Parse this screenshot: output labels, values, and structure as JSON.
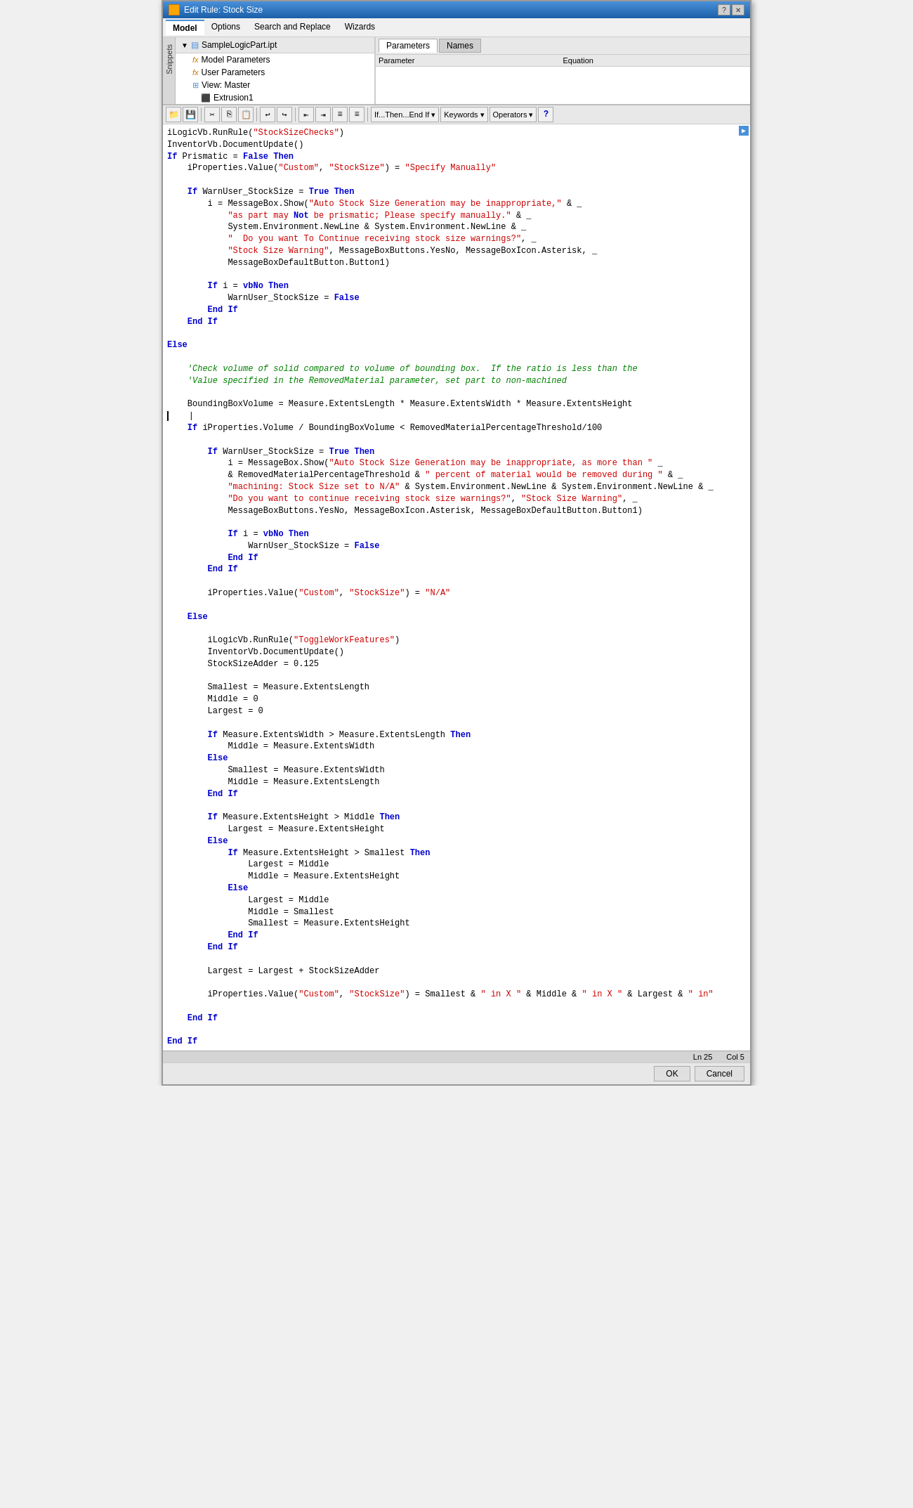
{
  "window": {
    "title": "Edit Rule: Stock Size",
    "icon": "edit-rule-icon"
  },
  "menu": {
    "tabs": [
      "Model",
      "Options",
      "Search and Replace",
      "Wizards"
    ],
    "active_tab": "Model"
  },
  "snippets": {
    "label": "Snippets"
  },
  "tree": {
    "root_label": "SampleLogicPart.ipt",
    "items": [
      {
        "label": "Model Parameters",
        "icon": "fx-icon",
        "indent": 1
      },
      {
        "label": "User Parameters",
        "icon": "fx-icon",
        "indent": 1
      },
      {
        "label": "View: Master",
        "icon": "view-icon",
        "indent": 1
      },
      {
        "label": "Extrusion1",
        "icon": "extrusion-icon",
        "indent": 2
      }
    ]
  },
  "params": {
    "tabs": [
      "Parameters",
      "Names"
    ],
    "active_tab": "Parameters",
    "columns": [
      "Parameter",
      "Equation"
    ]
  },
  "toolbar": {
    "buttons": [
      "open",
      "save",
      "cut",
      "copy",
      "paste",
      "undo",
      "redo",
      "indent-left",
      "indent-right",
      "align-left",
      "align-right"
    ],
    "dropdowns": [
      "If...Then...End If",
      "Keywords",
      "Operators"
    ],
    "help_icon": "help-icon"
  },
  "code": {
    "lines": [
      {
        "text": "iLogicVb.RunRule(\"StockSizeChecks\")",
        "type": "normal"
      },
      {
        "text": "InventorVb.DocumentUpdate()",
        "type": "normal"
      },
      {
        "text": "If Prismatic = False Then",
        "type": "keyword_line"
      },
      {
        "text": "    iProperties.Value(\"Custom\", \"StockSize\") = \"Specify Manually\"",
        "type": "mixed"
      },
      {
        "text": "",
        "type": "blank"
      },
      {
        "text": "    If WarnUser_StockSize = True Then",
        "type": "keyword_line"
      },
      {
        "text": "        i = MessageBox.Show(\"Auto Stock Size Generation may be inappropriate,\" & _",
        "type": "mixed"
      },
      {
        "text": "            \"as part may Not be prismatic; Please specify manually.\" & _",
        "type": "string_line"
      },
      {
        "text": "            System.Environment.NewLine & System.Environment.NewLine & _",
        "type": "mixed"
      },
      {
        "text": "            \"  Do you want To Continue receiving stock size warnings?\", _",
        "type": "string_line"
      },
      {
        "text": "            \"Stock Size Warning\", MessageBoxButtons.YesNo, MessageBoxIcon.Asterisk, _",
        "type": "string_line"
      },
      {
        "text": "            MessageBoxDefaultButton.Button1)",
        "type": "normal"
      },
      {
        "text": "",
        "type": "blank"
      },
      {
        "text": "        If i = vbNo Then",
        "type": "keyword_line"
      },
      {
        "text": "            WarnUser_StockSize = False",
        "type": "normal"
      },
      {
        "text": "        End If",
        "type": "keyword_line"
      },
      {
        "text": "    End If",
        "type": "keyword_line"
      },
      {
        "text": "",
        "type": "blank"
      },
      {
        "text": "Else",
        "type": "keyword_line"
      },
      {
        "text": "",
        "type": "blank"
      },
      {
        "text": "    'Check volume of solid compared to volume of bounding box.  If the ratio is less than the",
        "type": "comment"
      },
      {
        "text": "    'Value specified in the RemovedMaterial parameter, set part to non-machined",
        "type": "comment"
      },
      {
        "text": "",
        "type": "blank"
      },
      {
        "text": "    BoundingBoxVolume = Measure.ExtentsLength * Measure.ExtentsWidth * Measure.ExtentsHeight",
        "type": "normal"
      },
      {
        "text": "    |",
        "type": "cursor"
      },
      {
        "text": "    If iProperties.Volume / BoundingBoxVolume < RemovedMaterialPercentageThreshold/100",
        "type": "keyword_line"
      },
      {
        "text": "",
        "type": "blank"
      },
      {
        "text": "        If WarnUser_StockSize = True Then",
        "type": "keyword_line"
      },
      {
        "text": "            i = MessageBox.Show(\"Auto Stock Size Generation may be inappropriate, as more than \" _",
        "type": "mixed"
      },
      {
        "text": "            & RemovedMaterialPercentageThreshold & \" percent of material would be removed during \" & _",
        "type": "mixed"
      },
      {
        "text": "            \"machining: Stock Size set to N/A\" & System.Environment.NewLine & System.Environment.NewLine & _",
        "type": "string_line"
      },
      {
        "text": "            \"Do you want to continue receiving stock size warnings?\", \"Stock Size Warning\", _",
        "type": "string_line"
      },
      {
        "text": "            MessageBoxButtons.YesNo, MessageBoxIcon.Asterisk, MessageBoxDefaultButton.Button1)",
        "type": "normal"
      },
      {
        "text": "",
        "type": "blank"
      },
      {
        "text": "            If i = vbNo Then",
        "type": "keyword_line"
      },
      {
        "text": "                WarnUser_StockSize = False",
        "type": "normal"
      },
      {
        "text": "            End If",
        "type": "keyword_line"
      },
      {
        "text": "        End If",
        "type": "keyword_line"
      },
      {
        "text": "",
        "type": "blank"
      },
      {
        "text": "        iProperties.Value(\"Custom\", \"StockSize\") = \"N/A\"",
        "type": "mixed"
      },
      {
        "text": "",
        "type": "blank"
      },
      {
        "text": "    Else",
        "type": "keyword_line"
      },
      {
        "text": "",
        "type": "blank"
      },
      {
        "text": "        iLogicVb.RunRule(\"ToggleWorkFeatures\")",
        "type": "normal"
      },
      {
        "text": "        InventorVb.DocumentUpdate()",
        "type": "normal"
      },
      {
        "text": "        StockSizeAdder = 0.125",
        "type": "normal"
      },
      {
        "text": "",
        "type": "blank"
      },
      {
        "text": "        Smallest = Measure.ExtentsLength",
        "type": "normal"
      },
      {
        "text": "        Middle = 0",
        "type": "normal"
      },
      {
        "text": "        Largest = 0",
        "type": "normal"
      },
      {
        "text": "",
        "type": "blank"
      },
      {
        "text": "        If Measure.ExtentsWidth > Measure.ExtentsLength Then",
        "type": "keyword_line"
      },
      {
        "text": "            Middle = Measure.ExtentsWidth",
        "type": "normal"
      },
      {
        "text": "        Else",
        "type": "keyword_line"
      },
      {
        "text": "            Smallest = Measure.ExtentsWidth",
        "type": "normal"
      },
      {
        "text": "            Middle = Measure.ExtentsLength",
        "type": "normal"
      },
      {
        "text": "        End If",
        "type": "keyword_line"
      },
      {
        "text": "",
        "type": "blank"
      },
      {
        "text": "        If Measure.ExtentsHeight > Middle Then",
        "type": "keyword_line"
      },
      {
        "text": "            Largest = Measure.ExtentsHeight",
        "type": "normal"
      },
      {
        "text": "        Else",
        "type": "keyword_line"
      },
      {
        "text": "            If Measure.ExtentsHeight > Smallest Then",
        "type": "keyword_line"
      },
      {
        "text": "                Largest = Middle",
        "type": "normal"
      },
      {
        "text": "                Middle = Measure.ExtentsHeight",
        "type": "normal"
      },
      {
        "text": "            Else",
        "type": "keyword_line"
      },
      {
        "text": "                Largest = Middle",
        "type": "normal"
      },
      {
        "text": "                Middle = Smallest",
        "type": "normal"
      },
      {
        "text": "                Smallest = Measure.ExtentsHeight",
        "type": "normal"
      },
      {
        "text": "            End If",
        "type": "keyword_line"
      },
      {
        "text": "        End If",
        "type": "keyword_line"
      },
      {
        "text": "",
        "type": "blank"
      },
      {
        "text": "        Largest = Largest + StockSizeAdder",
        "type": "normal"
      },
      {
        "text": "",
        "type": "blank"
      },
      {
        "text": "        iProperties.Value(\"Custom\", \"StockSize\") = Smallest & \" in X \" & Middle & \" in X \" & Largest & \" in\"",
        "type": "mixed"
      },
      {
        "text": "",
        "type": "blank"
      },
      {
        "text": "    End If",
        "type": "keyword_line"
      },
      {
        "text": "",
        "type": "blank"
      },
      {
        "text": "End If",
        "type": "keyword_line"
      }
    ]
  },
  "status": {
    "line": "Ln 25",
    "col": "Col 5"
  },
  "actions": {
    "ok_label": "OK",
    "cancel_label": "Cancel"
  }
}
